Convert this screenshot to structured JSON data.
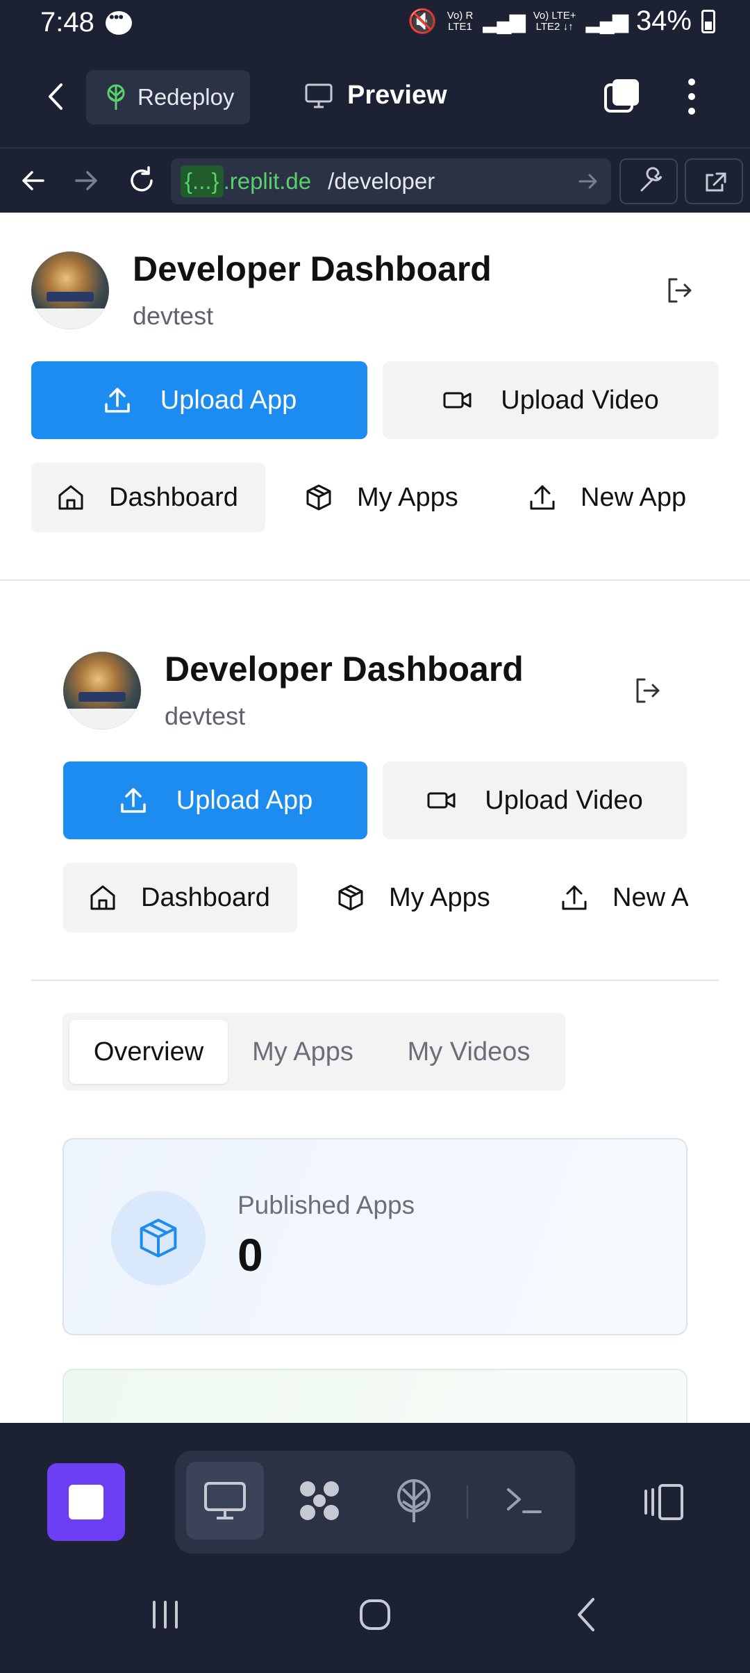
{
  "status_bar": {
    "time": "7:48",
    "net1": "Vo)) R\nLTE1",
    "net2": "Vo)) LTE+\nLTE2",
    "battery": "34%"
  },
  "replit_bar": {
    "redeploy_label": "Redeploy",
    "preview_label": "Preview"
  },
  "url_bar": {
    "badge": "{...}",
    "host": ".replit.de",
    "path": "/developer"
  },
  "header": {
    "title": "Developer Dashboard",
    "username": "devtest"
  },
  "actions": {
    "upload_app": "Upload App",
    "upload_video": "Upload Video"
  },
  "nav": {
    "dashboard": "Dashboard",
    "my_apps": "My Apps",
    "new_app": "New App"
  },
  "tabs": {
    "overview": "Overview",
    "my_apps": "My Apps",
    "my_videos": "My Videos"
  },
  "stats": {
    "published_label": "Published Apps",
    "published_value": "0"
  },
  "colors": {
    "accent": "#1d8cf0",
    "dark_bg": "#1c2133",
    "stop_button": "#6c3ff5"
  },
  "icons": {
    "upload": "upload-icon",
    "video": "video-camera-icon",
    "home": "home-icon",
    "box": "box-icon",
    "logout": "logout-icon"
  }
}
